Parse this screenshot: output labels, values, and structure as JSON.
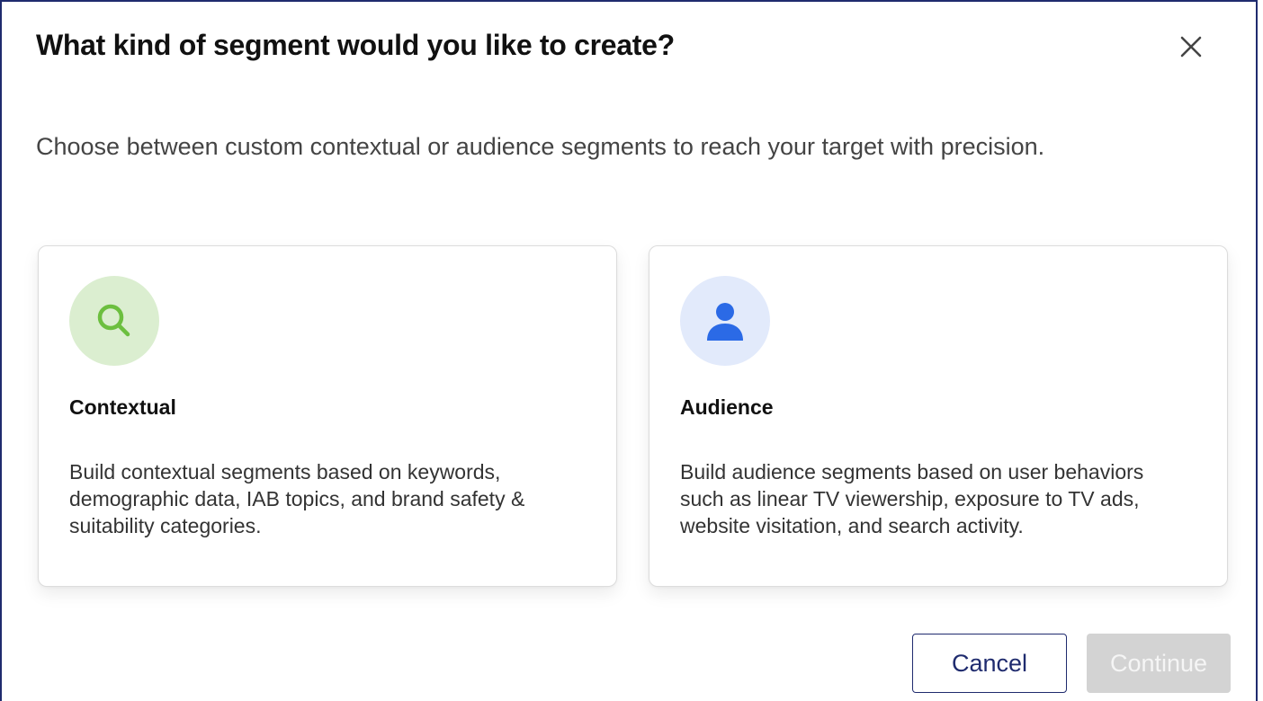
{
  "dialog": {
    "title": "What kind of segment would you like to create?",
    "description": "Choose between custom contextual or audience segments to reach your target with precision.",
    "close_icon": "close-icon"
  },
  "options": [
    {
      "title": "Contextual",
      "description": "Build contextual segments based on keywords, demographic data, IAB topics, and brand safety & suitability categories.",
      "icon": "search-icon",
      "icon_color": "#6cbf3f",
      "icon_bg": "#dbeed0"
    },
    {
      "title": "Audience",
      "description": "Build audience segments based on user behaviors such as linear TV viewership, exposure to TV ads, website visitation, and search activity.",
      "icon": "person-icon",
      "icon_color": "#2b6ae6",
      "icon_bg": "#e2eafb"
    }
  ],
  "footer": {
    "cancel_label": "Cancel",
    "continue_label": "Continue",
    "continue_disabled": true
  },
  "colors": {
    "border": "#1f2b6e",
    "primary_text": "#1f2b6e",
    "disabled_bg": "#d3d3d3"
  }
}
